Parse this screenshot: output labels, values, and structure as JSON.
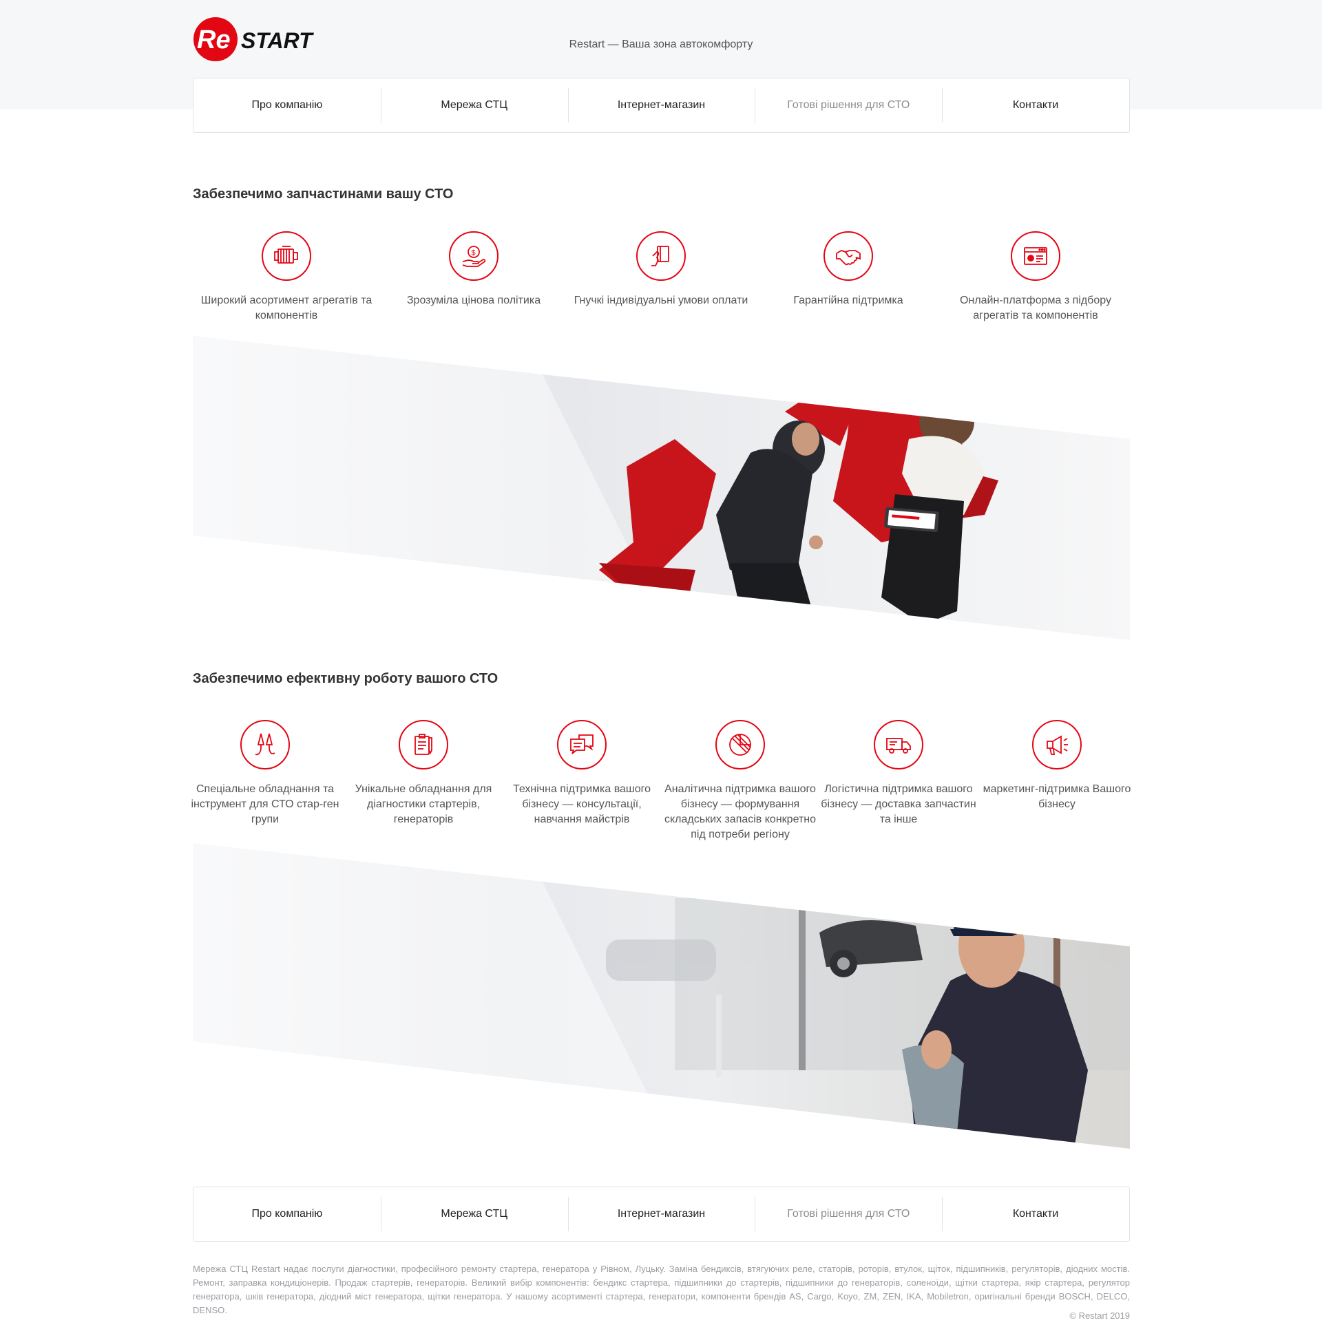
{
  "header": {
    "logo_text_re": "Re",
    "logo_text_start": "START",
    "tagline": "Restart — Ваша зона автокомфорту"
  },
  "nav": [
    {
      "label": "Про компанію"
    },
    {
      "label": "Мережа СТЦ"
    },
    {
      "label": "Інтернет-магазин"
    },
    {
      "label": "Готові рішення для СТО"
    },
    {
      "label": "Контакти"
    }
  ],
  "section1": {
    "title": "Забезпечимо запчастинами вашу СТО",
    "features": [
      {
        "icon": "engine-icon",
        "text": "Широкий асортимент агрегатів та компонентів"
      },
      {
        "icon": "money-hand-icon",
        "text": "Зрозуміла цінова політика"
      },
      {
        "icon": "card-hand-icon",
        "text": "Гнучкі індивідуальні умови оплати"
      },
      {
        "icon": "handshake-icon",
        "text": "Гарантійна підтримка"
      },
      {
        "icon": "browser-window-icon",
        "text": "Онлайн-платформа з підбору агрегатів та компонентів"
      }
    ]
  },
  "section2": {
    "title": "Забезпечимо ефективну роботу вашого СТО",
    "features": [
      {
        "icon": "jumper-cables-icon",
        "text": "Спеціальне обладнання та інструмент для СТО стар-ген групи"
      },
      {
        "icon": "clipboard-icon",
        "text": "Унікальне обладнання для діагностики стартерів, генераторів"
      },
      {
        "icon": "chat-bubbles-icon",
        "text": "Технічна підтримка вашого бізнесу — консультації, навчання майстрів"
      },
      {
        "icon": "analytics-icon",
        "text": "Аналітична підтримка вашого бізнесу — формування складських запасів конкретно під потреби регіону"
      },
      {
        "icon": "truck-icon",
        "text": "Логістична підтримка вашого бізнесу — доставка запчастин та інше"
      },
      {
        "icon": "megaphone-icon",
        "text": "маркетинг-підтримка Вашого бізнесу"
      }
    ]
  },
  "footer": {
    "description": "Мережа СТЦ Restart надає послуги діагностики, професійного ремонту стартера, генератора у Рівном, Луцьку. Заміна бендиксів, втягуючих реле, статорів, роторів, втулок, щіток, підшипників, регуляторів, діодних мостів. Ремонт, заправка кондиціонерів. Продаж стартерів, генераторів. Великий вибір компонентів: бендикс стартера, підшипники до стартерів, підшипники до генераторів, соленоїди, щітки стартера, якір стартера, регулятор генератора, шків генератора, діодний міст генератора, щітки генератора. У нашому асортименті стартера, генератори, компоненти брендів AS, Cargo, Koyo, ZM, ZEN, IKA, Mobiletron, оригінальні бренди BOSCH, DELCO, DENSO.",
    "copyright": "© Restart 2019"
  },
  "colors": {
    "accent": "#e30613",
    "band": "#f6f7f9",
    "chair": "#c8141b"
  }
}
